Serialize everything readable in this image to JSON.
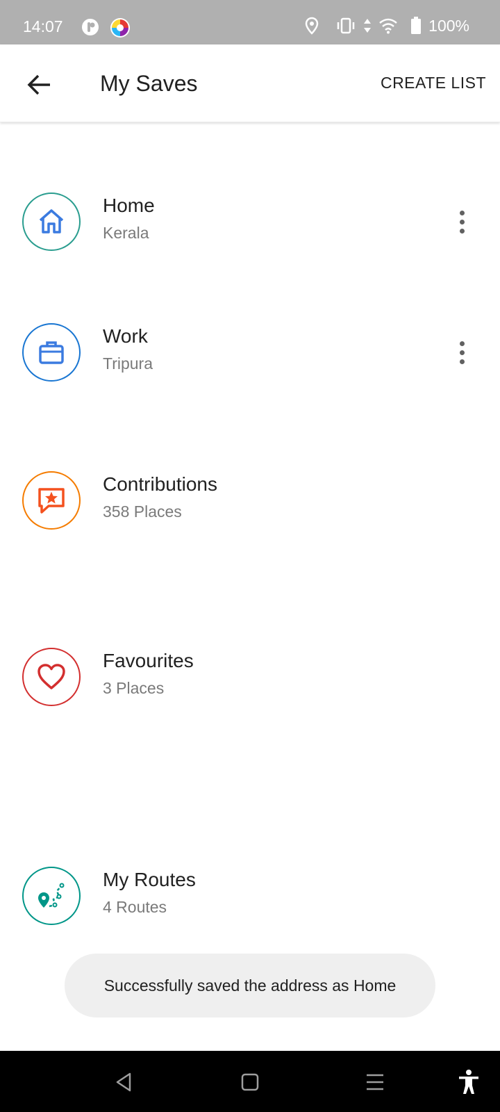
{
  "status_bar": {
    "time": "14:07",
    "battery": "100%",
    "icons": [
      "app-icon",
      "app-icon-colorful",
      "location-icon",
      "vibrate-icon",
      "data-arrows-icon",
      "wifi-icon",
      "battery-icon"
    ]
  },
  "app_bar": {
    "title": "My Saves",
    "action": "CREATE LIST"
  },
  "saves": {
    "home": {
      "title": "Home",
      "subtitle": "Kerala",
      "icon": "home-icon",
      "color": "#2a9d8f"
    },
    "work": {
      "title": "Work",
      "subtitle": "Tripura",
      "icon": "briefcase-icon",
      "color": "#1976d2"
    },
    "contributions": {
      "title": "Contributions",
      "subtitle": "358 Places",
      "icon": "star-chat-icon",
      "color": "#f57c00"
    },
    "favourites": {
      "title": "Favourites",
      "subtitle": "3 Places",
      "icon": "heart-icon",
      "color": "#d32f2f"
    },
    "routes": {
      "title": "My Routes",
      "subtitle": "4 Routes",
      "icon": "route-icon",
      "color": "#009688"
    }
  },
  "toast": {
    "message": "Successfully saved the address as Home"
  },
  "nav_bar": {
    "icons": [
      "back-triangle-icon",
      "home-square-icon",
      "menu-lines-icon",
      "accessibility-icon"
    ]
  }
}
